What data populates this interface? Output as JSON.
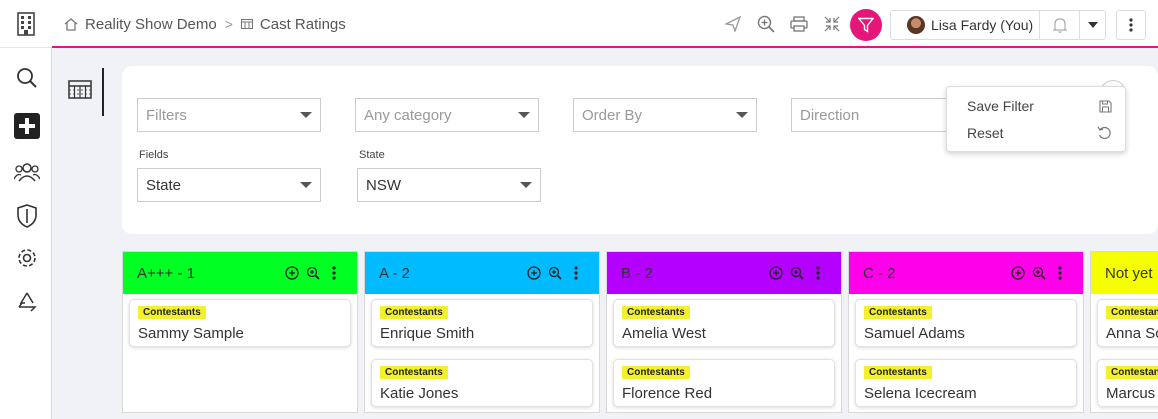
{
  "breadcrumb": {
    "home_label": "Reality Show Demo",
    "page_label": "Cast Ratings"
  },
  "user": {
    "name": "Lisa Fardy (You)"
  },
  "filters": {
    "filters_placeholder": "Filters",
    "category_placeholder": "Any category",
    "order_by_placeholder": "Order By",
    "direction_placeholder": "Direction",
    "fields_label": "Fields",
    "fields_value": "State",
    "state_label": "State",
    "state_value": "NSW"
  },
  "menu": {
    "save_filter": "Save Filter",
    "reset": "Reset"
  },
  "columns": [
    {
      "title": "A+++ - 1",
      "color": "#00ff22",
      "cards": [
        {
          "tag": "Contestants",
          "name": "Sammy Sample"
        }
      ]
    },
    {
      "title": "A - 2",
      "color": "#00bbff",
      "cards": [
        {
          "tag": "Contestants",
          "name": "Enrique Smith"
        },
        {
          "tag": "Contestants",
          "name": "Katie Jones"
        }
      ]
    },
    {
      "title": "B - 2",
      "color": "#b300ff",
      "cards": [
        {
          "tag": "Contestants",
          "name": "Amelia West"
        },
        {
          "tag": "Contestants",
          "name": "Florence Red"
        }
      ]
    },
    {
      "title": "C - 2",
      "color": "#ff00ea",
      "cards": [
        {
          "tag": "Contestants",
          "name": "Samuel Adams"
        },
        {
          "tag": "Contestants",
          "name": "Selena Icecream"
        }
      ]
    },
    {
      "title": "Not yet",
      "color": "#f6ff00",
      "cards": [
        {
          "tag": "Contestan",
          "name": "Anna Sc"
        },
        {
          "tag": "Contestan",
          "name": "Marcus"
        }
      ]
    }
  ],
  "colors": {
    "accent": "#e5157a",
    "tag": "#f3f02f"
  }
}
